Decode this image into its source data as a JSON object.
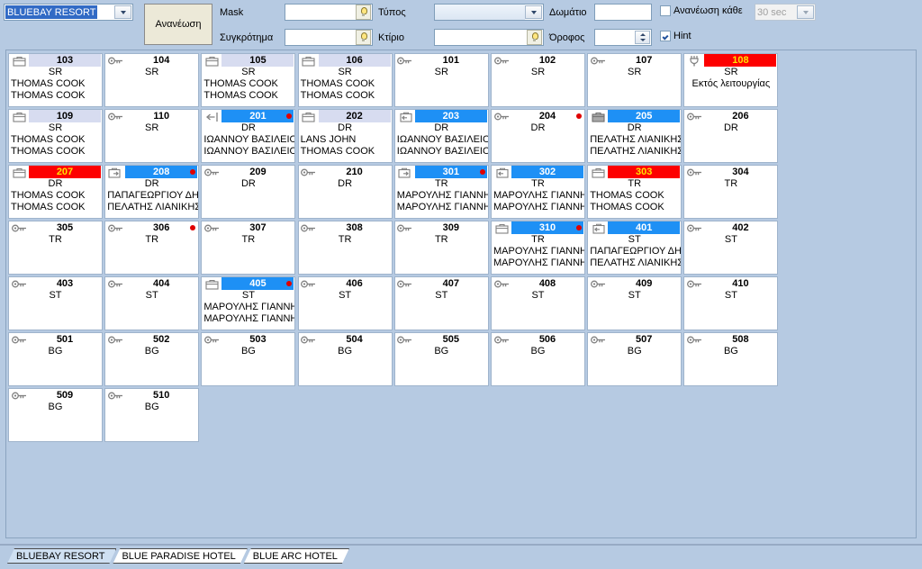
{
  "toolbar": {
    "hotel_select": {
      "value": "BLUEBAY RESORT",
      "icon": "chevron-down-icon"
    },
    "refresh_button": "Ανανέωση",
    "mask_label": "Mask",
    "mask_value": "",
    "complex_label": "Συγκρότημα",
    "complex_value": "",
    "type_label": "Τύπος",
    "type_value": "",
    "building_label": "Κτίριο",
    "building_value": "",
    "room_label": "Δωμάτιο",
    "room_value": "",
    "floor_label": "Όροφος",
    "floor_value": "",
    "auto_refresh_label": "Ανανέωση κάθε",
    "auto_refresh_checked": false,
    "interval_value": "30 sec",
    "hint_label": "Hint",
    "hint_checked": true
  },
  "colors": {
    "vacant": "#ffffff",
    "reserved": "#d7dcf0",
    "occupied": "#1e90f5",
    "out_of_order": "#fd0000",
    "out_of_order_text": "#ffe200",
    "dot": "#e00000",
    "panel_bg": "#b6cae2",
    "selection": "#316ac5"
  },
  "legend_status_meaning": {
    "vacant": "white header, key icon",
    "reserved": "lavender header, briefcase icon",
    "occupied": "blue header, white number",
    "out_of_order": "red header, yellow number"
  },
  "rooms": [
    {
      "number": "103",
      "type": "SR",
      "status": "reserved",
      "icon": "briefcase-icon",
      "dot": false,
      "line1": "THOMAS COOK",
      "line2": "THOMAS COOK",
      "note": ""
    },
    {
      "number": "104",
      "type": "SR",
      "status": "vacant",
      "icon": "key-icon",
      "dot": false,
      "line1": "",
      "line2": "",
      "note": ""
    },
    {
      "number": "105",
      "type": "SR",
      "status": "reserved",
      "icon": "briefcase-icon",
      "dot": false,
      "line1": "THOMAS COOK",
      "line2": "THOMAS COOK",
      "note": ""
    },
    {
      "number": "106",
      "type": "SR",
      "status": "reserved",
      "icon": "briefcase-icon",
      "dot": false,
      "line1": "THOMAS COOK",
      "line2": "THOMAS COOK",
      "note": ""
    },
    {
      "number": "101",
      "type": "SR",
      "status": "vacant",
      "icon": "key-icon",
      "dot": false,
      "line1": "",
      "line2": "",
      "note": ""
    },
    {
      "number": "102",
      "type": "SR",
      "status": "vacant",
      "icon": "key-icon",
      "dot": false,
      "line1": "",
      "line2": "",
      "note": ""
    },
    {
      "number": "107",
      "type": "SR",
      "status": "vacant",
      "icon": "key-icon",
      "dot": false,
      "line1": "",
      "line2": "",
      "note": ""
    },
    {
      "number": "108",
      "type": "SR",
      "status": "ooo",
      "icon": "wrench-icon",
      "dot": false,
      "line1": "",
      "line2": "",
      "note": "Εκτός λειτουργίας"
    },
    {
      "number": "109",
      "type": "SR",
      "status": "reserved",
      "icon": "briefcase-icon",
      "dot": false,
      "line1": "THOMAS COOK",
      "line2": "THOMAS COOK",
      "note": ""
    },
    {
      "number": "110",
      "type": "SR",
      "status": "vacant",
      "icon": "key-icon",
      "dot": false,
      "line1": "",
      "line2": "",
      "note": ""
    },
    {
      "number": "201",
      "type": "DR",
      "status": "occupied",
      "icon": "arrow-left-icon",
      "dot": true,
      "line1": "ΙΩΑΝΝΟΥ ΒΑΣΙΛΕΙΟΣ",
      "line2": "ΙΩΑΝΝΟΥ ΒΑΣΙΛΕΙΟΣ",
      "note": ""
    },
    {
      "number": "202",
      "type": "DR",
      "status": "reserved",
      "icon": "briefcase-icon",
      "dot": false,
      "line1": "LANS JOHN",
      "line2": "THOMAS COOK",
      "note": ""
    },
    {
      "number": "203",
      "type": "DR",
      "status": "occupied",
      "icon": "briefcase-checkin-icon",
      "dot": false,
      "line1": "ΙΩΑΝΝΟΥ ΒΑΣΙΛΕΙΟΣ",
      "line2": "ΙΩΑΝΝΟΥ ΒΑΣΙΛΕΙΟΣ",
      "note": ""
    },
    {
      "number": "204",
      "type": "DR",
      "status": "vacant",
      "icon": "key-icon",
      "dot": true,
      "line1": "",
      "line2": "",
      "note": ""
    },
    {
      "number": "205",
      "type": "DR",
      "status": "occupied",
      "icon": "briefcase-grey-icon",
      "dot": false,
      "line1": "ΠΕΛΑΤΗΣ ΛΙΑΝΙΚΗΣ",
      "line2": "ΠΕΛΑΤΗΣ ΛΙΑΝΙΚΗΣ",
      "note": ""
    },
    {
      "number": "206",
      "type": "DR",
      "status": "vacant",
      "icon": "key-icon",
      "dot": false,
      "line1": "",
      "line2": "",
      "note": ""
    },
    {
      "number": "207",
      "type": "DR",
      "status": "ooo",
      "icon": "briefcase-icon",
      "dot": false,
      "line1": "THOMAS COOK",
      "line2": "THOMAS COOK",
      "note": ""
    },
    {
      "number": "208",
      "type": "DR",
      "status": "occupied",
      "icon": "briefcase-checkout-icon",
      "dot": true,
      "line1": "ΠΑΠΑΓΕΩΡΓΙΟΥ ΔΗΜ",
      "line2": "ΠΕΛΑΤΗΣ ΛΙΑΝΙΚΗΣ",
      "note": ""
    },
    {
      "number": "209",
      "type": "DR",
      "status": "vacant",
      "icon": "key-icon",
      "dot": false,
      "line1": "",
      "line2": "",
      "note": ""
    },
    {
      "number": "210",
      "type": "DR",
      "status": "vacant",
      "icon": "key-icon",
      "dot": false,
      "line1": "",
      "line2": "",
      "note": ""
    },
    {
      "number": "301",
      "type": "TR",
      "status": "occupied",
      "icon": "briefcase-checkout-icon",
      "dot": true,
      "line1": "ΜΑΡΟΥΛΗΣ ΓΙΑΝΝΗΣ",
      "line2": "ΜΑΡΟΥΛΗΣ ΓΙΑΝΝΗΣ",
      "note": ""
    },
    {
      "number": "302",
      "type": "TR",
      "status": "occupied",
      "icon": "briefcase-checkin-icon",
      "dot": false,
      "line1": "ΜΑΡΟΥΛΗΣ ΓΙΑΝΝΗΣ",
      "line2": "ΜΑΡΟΥΛΗΣ ΓΙΑΝΝΗΣ",
      "note": ""
    },
    {
      "number": "303",
      "type": "TR",
      "status": "ooo",
      "icon": "briefcase-icon",
      "dot": false,
      "line1": "THOMAS COOK",
      "line2": "THOMAS COOK",
      "note": ""
    },
    {
      "number": "304",
      "type": "TR",
      "status": "vacant",
      "icon": "key-icon",
      "dot": false,
      "line1": "",
      "line2": "",
      "note": ""
    },
    {
      "number": "305",
      "type": "TR",
      "status": "vacant",
      "icon": "key-icon",
      "dot": false,
      "line1": "",
      "line2": "",
      "note": ""
    },
    {
      "number": "306",
      "type": "TR",
      "status": "vacant",
      "icon": "key-icon",
      "dot": true,
      "line1": "",
      "line2": "",
      "note": ""
    },
    {
      "number": "307",
      "type": "TR",
      "status": "vacant",
      "icon": "key-icon",
      "dot": false,
      "line1": "",
      "line2": "",
      "note": ""
    },
    {
      "number": "308",
      "type": "TR",
      "status": "vacant",
      "icon": "key-icon",
      "dot": false,
      "line1": "",
      "line2": "",
      "note": ""
    },
    {
      "number": "309",
      "type": "TR",
      "status": "vacant",
      "icon": "key-icon",
      "dot": false,
      "line1": "",
      "line2": "",
      "note": ""
    },
    {
      "number": "310",
      "type": "TR",
      "status": "occupied",
      "icon": "briefcase-icon",
      "dot": true,
      "line1": "ΜΑΡΟΥΛΗΣ ΓΙΑΝΝΗΣ",
      "line2": "ΜΑΡΟΥΛΗΣ ΓΙΑΝΝΗΣ",
      "note": ""
    },
    {
      "number": "401",
      "type": "ST",
      "status": "occupied",
      "icon": "briefcase-checkin-icon",
      "dot": false,
      "line1": "ΠΑΠΑΓΕΩΡΓΙΟΥ ΔΗΜ",
      "line2": "ΠΕΛΑΤΗΣ ΛΙΑΝΙΚΗΣ",
      "note": ""
    },
    {
      "number": "402",
      "type": "ST",
      "status": "vacant",
      "icon": "key-icon",
      "dot": false,
      "line1": "",
      "line2": "",
      "note": ""
    },
    {
      "number": "403",
      "type": "ST",
      "status": "vacant",
      "icon": "key-icon",
      "dot": false,
      "line1": "",
      "line2": "",
      "note": ""
    },
    {
      "number": "404",
      "type": "ST",
      "status": "vacant",
      "icon": "key-icon",
      "dot": false,
      "line1": "",
      "line2": "",
      "note": ""
    },
    {
      "number": "405",
      "type": "ST",
      "status": "occupied",
      "icon": "briefcase-icon",
      "dot": true,
      "line1": "ΜΑΡΟΥΛΗΣ ΓΙΑΝΝΗΣ",
      "line2": "ΜΑΡΟΥΛΗΣ ΓΙΑΝΝΗΣ",
      "note": ""
    },
    {
      "number": "406",
      "type": "ST",
      "status": "vacant",
      "icon": "key-icon",
      "dot": false,
      "line1": "",
      "line2": "",
      "note": ""
    },
    {
      "number": "407",
      "type": "ST",
      "status": "vacant",
      "icon": "key-icon",
      "dot": false,
      "line1": "",
      "line2": "",
      "note": ""
    },
    {
      "number": "408",
      "type": "ST",
      "status": "vacant",
      "icon": "key-icon",
      "dot": false,
      "line1": "",
      "line2": "",
      "note": ""
    },
    {
      "number": "409",
      "type": "ST",
      "status": "vacant",
      "icon": "key-icon",
      "dot": false,
      "line1": "",
      "line2": "",
      "note": ""
    },
    {
      "number": "410",
      "type": "ST",
      "status": "vacant",
      "icon": "key-icon",
      "dot": false,
      "line1": "",
      "line2": "",
      "note": ""
    },
    {
      "number": "501",
      "type": "BG",
      "status": "vacant",
      "icon": "key-icon",
      "dot": false,
      "line1": "",
      "line2": "",
      "note": ""
    },
    {
      "number": "502",
      "type": "BG",
      "status": "vacant",
      "icon": "key-icon",
      "dot": false,
      "line1": "",
      "line2": "",
      "note": ""
    },
    {
      "number": "503",
      "type": "BG",
      "status": "vacant",
      "icon": "key-icon",
      "dot": false,
      "line1": "",
      "line2": "",
      "note": ""
    },
    {
      "number": "504",
      "type": "BG",
      "status": "vacant",
      "icon": "key-icon",
      "dot": false,
      "line1": "",
      "line2": "",
      "note": ""
    },
    {
      "number": "505",
      "type": "BG",
      "status": "vacant",
      "icon": "key-icon",
      "dot": false,
      "line1": "",
      "line2": "",
      "note": ""
    },
    {
      "number": "506",
      "type": "BG",
      "status": "vacant",
      "icon": "key-icon",
      "dot": false,
      "line1": "",
      "line2": "",
      "note": ""
    },
    {
      "number": "507",
      "type": "BG",
      "status": "vacant",
      "icon": "key-icon",
      "dot": false,
      "line1": "",
      "line2": "",
      "note": ""
    },
    {
      "number": "508",
      "type": "BG",
      "status": "vacant",
      "icon": "key-icon",
      "dot": false,
      "line1": "",
      "line2": "",
      "note": ""
    },
    {
      "number": "509",
      "type": "BG",
      "status": "vacant",
      "icon": "key-icon",
      "dot": false,
      "line1": "",
      "line2": "",
      "note": ""
    },
    {
      "number": "510",
      "type": "BG",
      "status": "vacant",
      "icon": "key-icon",
      "dot": false,
      "line1": "",
      "line2": "",
      "note": ""
    }
  ],
  "tabs": [
    {
      "label": "BLUEBAY RESORT",
      "active": true
    },
    {
      "label": "BLUE PARADISE HOTEL",
      "active": false
    },
    {
      "label": "BLUE ARC HOTEL",
      "active": false
    }
  ]
}
